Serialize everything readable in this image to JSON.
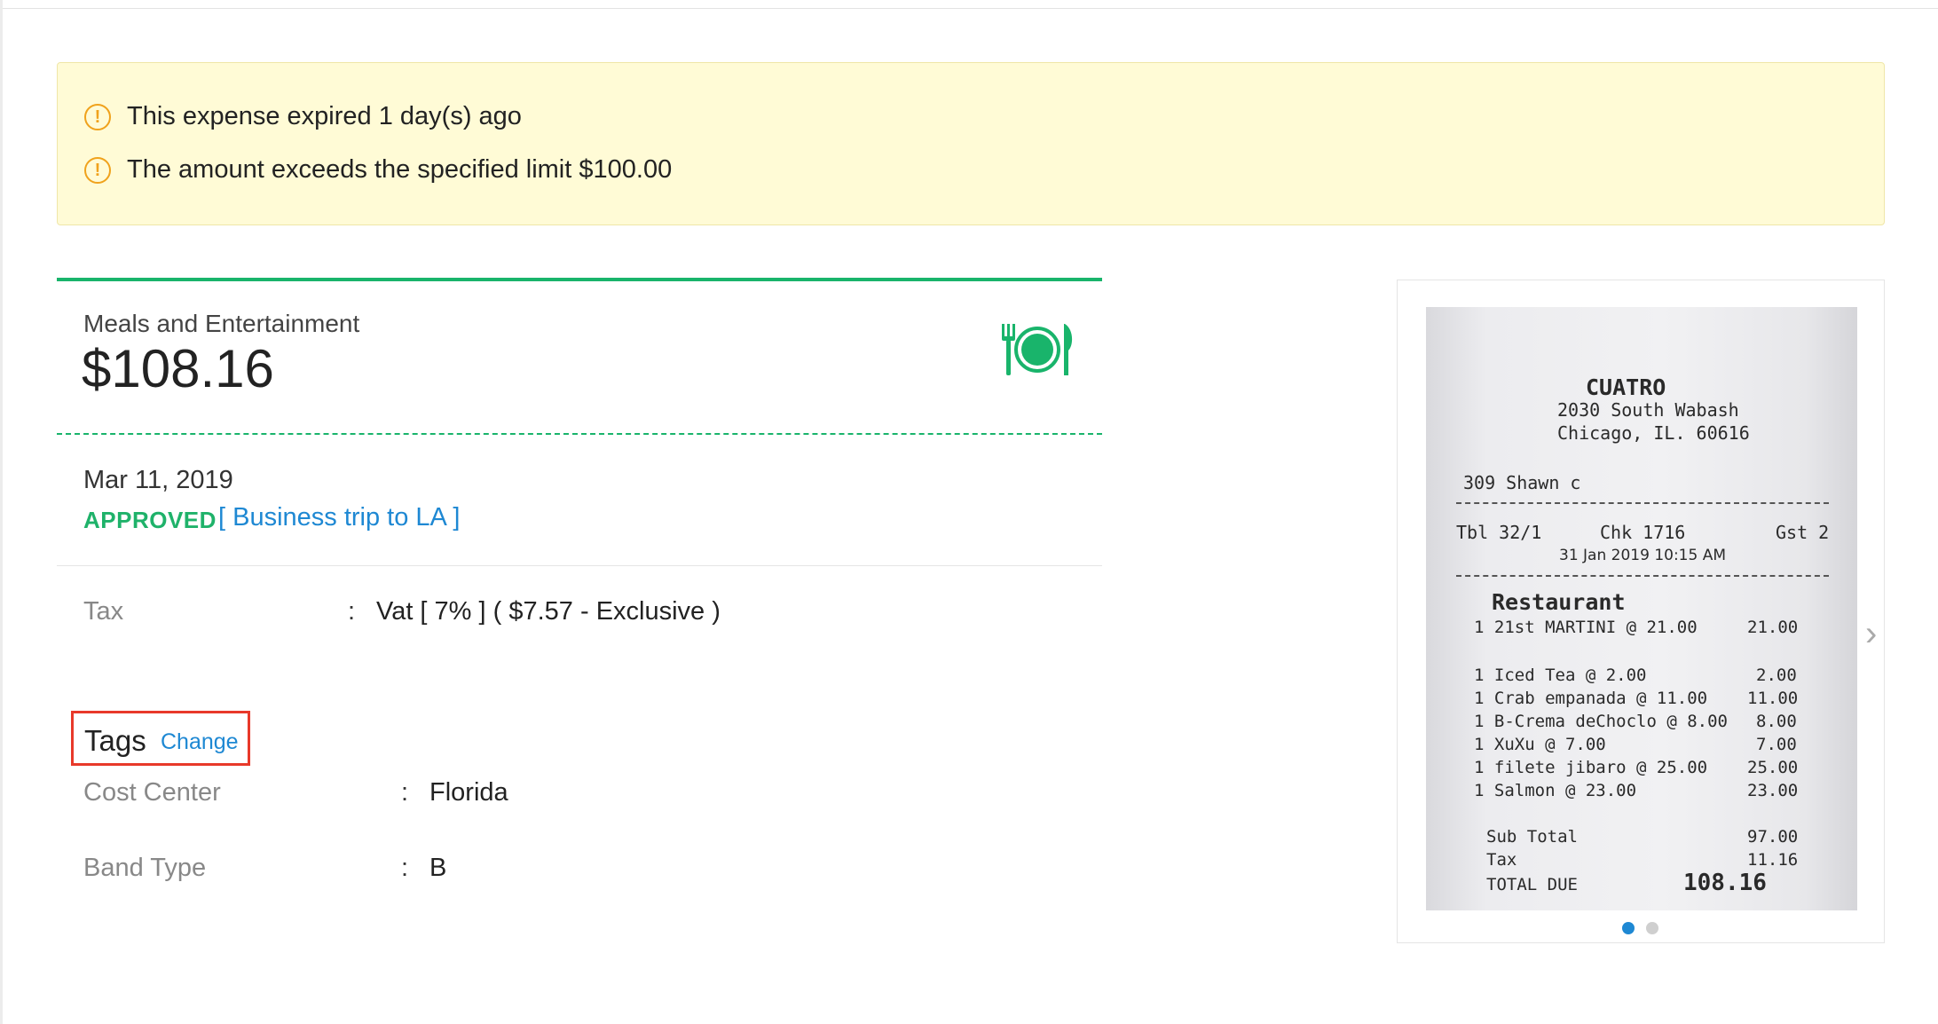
{
  "alerts": [
    {
      "icon": "warning-icon",
      "text": "This expense expired 1 day(s) ago"
    },
    {
      "icon": "warning-icon",
      "text": "The amount exceeds the specified limit $100.00"
    }
  ],
  "expense": {
    "category": "Meals and Entertainment",
    "amount": "$108.16",
    "category_icon": "fork-plate-knife-icon",
    "date": "Mar 11, 2019",
    "status": "APPROVED",
    "report_link": "[ Business trip to LA ]"
  },
  "tax": {
    "label": "Tax",
    "value": "Vat [ 7% ] ( $7.57 - Exclusive )"
  },
  "tags": {
    "title": "Tags",
    "change_label": "Change",
    "items": [
      {
        "label": "Cost Center",
        "value": "Florida"
      },
      {
        "label": "Band Type",
        "value": "B"
      }
    ]
  },
  "receipt": {
    "name": "CUATRO",
    "address1": "2030 South Wabash",
    "address2": "Chicago, IL. 60616",
    "server": "309 Shawn c",
    "table": "Tbl 32/1",
    "check": "Chk 1716",
    "guests": "Gst 2",
    "datetime": "31 Jan 2019 10:15 AM",
    "section": "Restaurant",
    "lines": [
      {
        "item": "1 21st MARTINI @ 21.00",
        "price": "21.00"
      },
      {
        "item": "1 Iced Tea @ 2.00",
        "price": "2.00"
      },
      {
        "item": "1 Crab empanada @ 11.00",
        "price": "11.00"
      },
      {
        "item": "1 B-Crema deChoclo @ 8.00",
        "price": "8.00"
      },
      {
        "item": "1 XuXu @ 7.00",
        "price": "7.00"
      },
      {
        "item": "1 filete jibaro @ 25.00",
        "price": "25.00"
      },
      {
        "item": "1 Salmon @ 23.00",
        "price": "23.00"
      }
    ],
    "subtotal_label": "Sub Total",
    "subtotal": "97.00",
    "tax_label": "Tax",
    "tax": "11.16",
    "total_label": "TOTAL DUE",
    "total": "108.16"
  },
  "carousel": {
    "pages": 2,
    "active": 1
  },
  "colors": {
    "accent": "#19b46b",
    "link": "#1e88d3",
    "warning": "#f0a21c",
    "highlight": "#e8392a",
    "alert_bg": "#fffbd6"
  }
}
